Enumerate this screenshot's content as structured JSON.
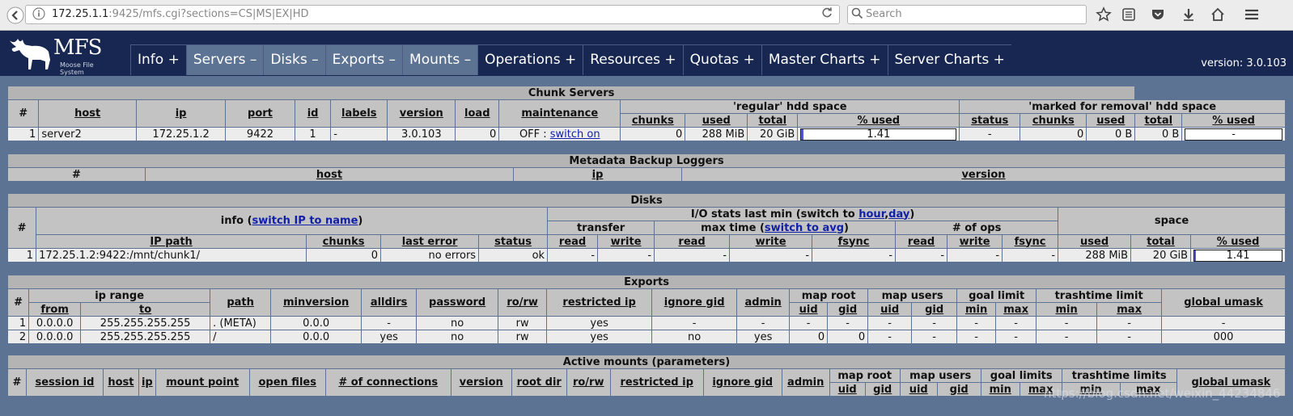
{
  "browser": {
    "url_host": "172.25.1.1",
    "url_rest": ":9425/mfs.cgi?sections=CS|MS|EX|HD",
    "search_placeholder": "Search"
  },
  "header": {
    "logo_text": "MFS",
    "logo_sub": "Moose File System",
    "version": "version: 3.0.103",
    "tabs": [
      {
        "label": "Info +",
        "selected": false
      },
      {
        "label": "Servers –",
        "selected": true
      },
      {
        "label": "Disks –",
        "selected": true
      },
      {
        "label": "Exports –",
        "selected": true
      },
      {
        "label": "Mounts –",
        "selected": true
      },
      {
        "label": "Operations +",
        "selected": false
      },
      {
        "label": "Resources +",
        "selected": false
      },
      {
        "label": "Quotas +",
        "selected": false
      },
      {
        "label": "Master Charts +",
        "selected": false
      },
      {
        "label": "Server Charts +",
        "selected": false
      }
    ]
  },
  "chunk_servers": {
    "title": "Chunk Servers",
    "regular_hdd": "'regular' hdd space",
    "marked_hdd": "'marked for removal' hdd space",
    "headers": {
      "num": "#",
      "host": "host",
      "ip": "ip",
      "port": "port",
      "id": "id",
      "labels": "labels",
      "version": "version",
      "load": "load",
      "maintenance": "maintenance",
      "chunks": "chunks",
      "used": "used",
      "total": "total",
      "pct_used": "% used",
      "status": "status"
    },
    "rows": [
      {
        "num": "1",
        "host": "server2",
        "ip": "172.25.1.2",
        "port": "9422",
        "id": "1",
        "labels": "-",
        "version": "3.0.103",
        "load": "0",
        "maint_prefix": "OFF : ",
        "maint_link": "switch on",
        "chunks": "0",
        "used": "288 MiB",
        "total": "20 GiB",
        "pct": "1.41",
        "pct_value": 1.41,
        "m_status": "-",
        "m_chunks": "0",
        "m_used": "0 B",
        "m_total": "0 B",
        "m_pct": "-"
      }
    ]
  },
  "metadata_loggers": {
    "title": "Metadata Backup Loggers",
    "headers": {
      "num": "#",
      "host": "host",
      "ip": "ip",
      "version": "version"
    }
  },
  "disks": {
    "title": "Disks",
    "info_prefix": "info (",
    "info_link": "switch IP to name",
    "info_suffix": ")",
    "io_prefix": "I/O stats last min (switch to ",
    "io_link1": "hour",
    "io_sep": ",",
    "io_link2": "day",
    "io_suffix": ")",
    "space": "space",
    "transfer": "transfer",
    "maxtime_prefix": "max time (",
    "maxtime_link": "switch to avg",
    "maxtime_suffix": ")",
    "ops": "# of ops",
    "headers": {
      "num": "#",
      "ip_path": "IP path",
      "chunks": "chunks",
      "last_error": "last error",
      "status": "status",
      "read": "read",
      "write": "write",
      "fsync": "fsync",
      "used": "used",
      "total": "total",
      "pct_used": "% used"
    },
    "rows": [
      {
        "num": "1",
        "ip_path": "172.25.1.2:9422:/mnt/chunk1/",
        "chunks": "0",
        "last_error": "no errors",
        "status": "ok",
        "t_read": "-",
        "t_write": "-",
        "mt_read": "-",
        "mt_write": "-",
        "mt_fsync": "-",
        "op_read": "-",
        "op_write": "-",
        "op_fsync": "-",
        "used": "288 MiB",
        "total": "20 GiB",
        "pct": "1.41",
        "pct_value": 1.41
      }
    ]
  },
  "exports": {
    "title": "Exports",
    "headers": {
      "num": "#",
      "ip_range": "ip range",
      "from": "from",
      "to": "to",
      "path": "path",
      "minversion": "minversion",
      "alldirs": "alldirs",
      "password": "password",
      "rorw": "ro/rw",
      "restricted_ip": "restricted ip",
      "ignore_gid": "ignore gid",
      "admin": "admin",
      "map_root": "map root",
      "map_users": "map users",
      "goal_limit": "goal limit",
      "trashtime_limit": "trashtime limit",
      "global_umask": "global umask",
      "uid": "uid",
      "gid": "gid",
      "min": "min",
      "max": "max"
    },
    "rows": [
      {
        "num": "1",
        "from": "0.0.0.0",
        "to": "255.255.255.255",
        "path": ". (META)",
        "minversion": "0.0.0",
        "alldirs": "-",
        "password": "no",
        "rorw": "rw",
        "restricted_ip": "yes",
        "ignore_gid": "-",
        "admin": "-",
        "mr_uid": "-",
        "mr_gid": "-",
        "mu_uid": "-",
        "mu_gid": "-",
        "g_min": "-",
        "g_max": "-",
        "t_min": "-",
        "t_max": "-",
        "umask": "-"
      },
      {
        "num": "2",
        "from": "0.0.0.0",
        "to": "255.255.255.255",
        "path": "/",
        "minversion": "0.0.0",
        "alldirs": "yes",
        "password": "no",
        "rorw": "rw",
        "restricted_ip": "yes",
        "ignore_gid": "no",
        "admin": "yes",
        "mr_uid": "0",
        "mr_gid": "0",
        "mu_uid": "-",
        "mu_gid": "-",
        "g_min": "-",
        "g_max": "-",
        "t_min": "-",
        "t_max": "-",
        "umask": "000"
      }
    ]
  },
  "active_mounts": {
    "title": "Active mounts (parameters)",
    "headers": {
      "num": "#",
      "session_id": "session id",
      "host": "host",
      "ip": "ip",
      "mount_point": "mount point",
      "open_files": "open files",
      "connections": "# of connections",
      "version": "version",
      "root_dir": "root dir",
      "rorw": "ro/rw",
      "restricted_ip": "restricted ip",
      "ignore_gid": "ignore gid",
      "admin": "admin",
      "map_root": "map root",
      "map_users": "map users",
      "goal_limits": "goal limits",
      "trashtime_limits": "trashtime limits",
      "global_umask": "global umask",
      "uid": "uid",
      "gid": "gid",
      "min": "min",
      "max": "max"
    }
  },
  "watermark": "https://blog.csdn.net/weixin_44234846"
}
